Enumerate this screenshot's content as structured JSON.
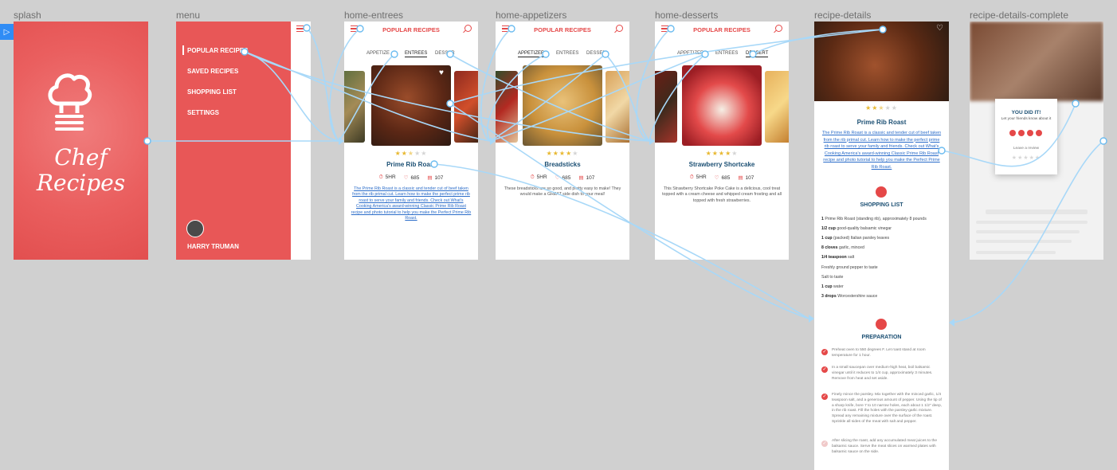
{
  "artboards": [
    {
      "id": "splash",
      "label": "splash"
    },
    {
      "id": "menu",
      "label": "menu"
    },
    {
      "id": "home-entrees",
      "label": "home-entrees"
    },
    {
      "id": "home-appetizers",
      "label": "home-appetizers"
    },
    {
      "id": "home-desserts",
      "label": "home-desserts"
    },
    {
      "id": "recipe-details",
      "label": "recipe-details"
    },
    {
      "id": "recipe-details-complete",
      "label": "recipe-details-complete"
    }
  ],
  "play_icon": "play-icon",
  "splash": {
    "title_line1": "Chef",
    "title_line2": "Recipes",
    "icon": "chef-hat-icon"
  },
  "menu": {
    "items": [
      {
        "label": "POPULAR RECIPES"
      },
      {
        "label": "SAVED RECIPES"
      },
      {
        "label": "SHOPPING LIST"
      },
      {
        "label": "SETTINGS"
      }
    ],
    "user_name": "HARRY TRUMAN"
  },
  "header": {
    "title": "POPULAR RECIPES"
  },
  "tabs": {
    "appetizers": "APPETIZERS",
    "entrees": "ENTREES",
    "desserts": "DESSERTS"
  },
  "entrees": {
    "tabs": {
      "appetizers": "APPETIZE",
      "entrees": "ENTREES",
      "desserts": "DESSER"
    },
    "title": "Prime Rib Roast",
    "rating": 2.5,
    "time": "5HR",
    "likes": "685",
    "comments": "107",
    "description": "The Prime Rib Roast is a classic and tender cut of beef taken from the rib primal cut. Learn how to make the perfect prime rib roast to serve your family and friends. Check out What's Cooking America's award-winning Classic Prime Rib Roast recipe and photo tutorial to help you make the Perfect Prime Rib Roast."
  },
  "appetizers": {
    "tabs": {
      "appetizers": "APPETIZERS",
      "entrees": "ENTREES",
      "desserts": "DESSER"
    },
    "title": "Breadsticks",
    "rating": 4,
    "time": "5HR",
    "likes": "685",
    "comments": "107",
    "description": "These breadsticks are so good, and pretty easy to make! They would make a GREAT side dish to your meal!"
  },
  "desserts": {
    "tabs": {
      "appetizers": "APPETIZERS",
      "entrees": "ENTREES",
      "desserts": "DESSERT"
    },
    "title": "Strawberry Shortcake",
    "rating": 4,
    "time": "5HR",
    "likes": "685",
    "comments": "107",
    "description": "This Strawberry Shortcake Poke Cake is a delicious, cool treat topped with a cream cheese and whipped cream frosting and all topped with fresh strawberries."
  },
  "details": {
    "title": "Prime Rib Roast",
    "rating": 2.5,
    "description": "The Prime Rib Roast is a classic and tender cut of beef taken from the rib primal cut. Learn how to make the perfect prime rib roast to serve your family and friends. Check out What's Cooking America's award-winning Classic Prime Rib Roast recipe and photo tutorial to help you make the Perfect Prime Rib Roast.",
    "shopping_title": "SHOPPING LIST",
    "ingredients": [
      {
        "qty": "1",
        "text": "Prime Rib Roast (standing rib), approximately 8 pounds"
      },
      {
        "qty": "1/2 cup",
        "text": "good-quality balsamic vinegar"
      },
      {
        "qty": "1 cup",
        "text": "(packed) Italian parsley leaves"
      },
      {
        "qty": "8 cloves",
        "text": "garlic, minced"
      },
      {
        "qty": "1/4 teaspoon",
        "text": "salt"
      },
      {
        "qty": "",
        "text": "Freshly ground pepper to taste"
      },
      {
        "qty": "",
        "text": "Salt to taste"
      },
      {
        "qty": "1 cup",
        "text": "water"
      },
      {
        "qty": "3 drops",
        "text": "Worcestershire sauce"
      }
    ],
    "prep_title": "PREPARATION",
    "steps": [
      {
        "done": true,
        "text": "Preheat oven to 550 degrees F. Let roast stand at room temperature for 1 hour."
      },
      {
        "done": true,
        "text": "In a small saucepan over medium-high heat, boil balsamic vinegar until it reduces to 1/4 cup, approximately 3 minutes. Remove from heat and set aside."
      },
      {
        "done": true,
        "text": "Finely mince the parsley. Mix together with the minced garlic, 1/4 teaspoon salt, and a generous amount of pepper. Using the tip of a sharp knife, bore 7 to 10 narrow holes, each about 1 1/2\" deep, in the rib roast. Fill the holes with the parsley-garlic mixture. Spread any remaining mixture over the surface of the roast. Sprinkle all sides of the meat with salt and pepper."
      },
      {
        "done": false,
        "text": "After slicing the roast, add any accumulated meat juices to the balsamic sauce. Serve the meat slices on warmed plates with balsamic sauce on the side."
      }
    ]
  },
  "complete": {
    "title": "YOU DID IT!",
    "subtitle": "Let your friends know about it",
    "leave_review": "Leave a review",
    "share_icons": [
      "google-plus-icon",
      "facebook-icon",
      "pinterest-icon",
      "twitter-icon"
    ]
  },
  "colors": {
    "brand": "#e85757",
    "link": "#2a6cc9",
    "heading": "#1b4f73",
    "flow": "#9fd3f5",
    "canvas": "#d0d0d0"
  }
}
